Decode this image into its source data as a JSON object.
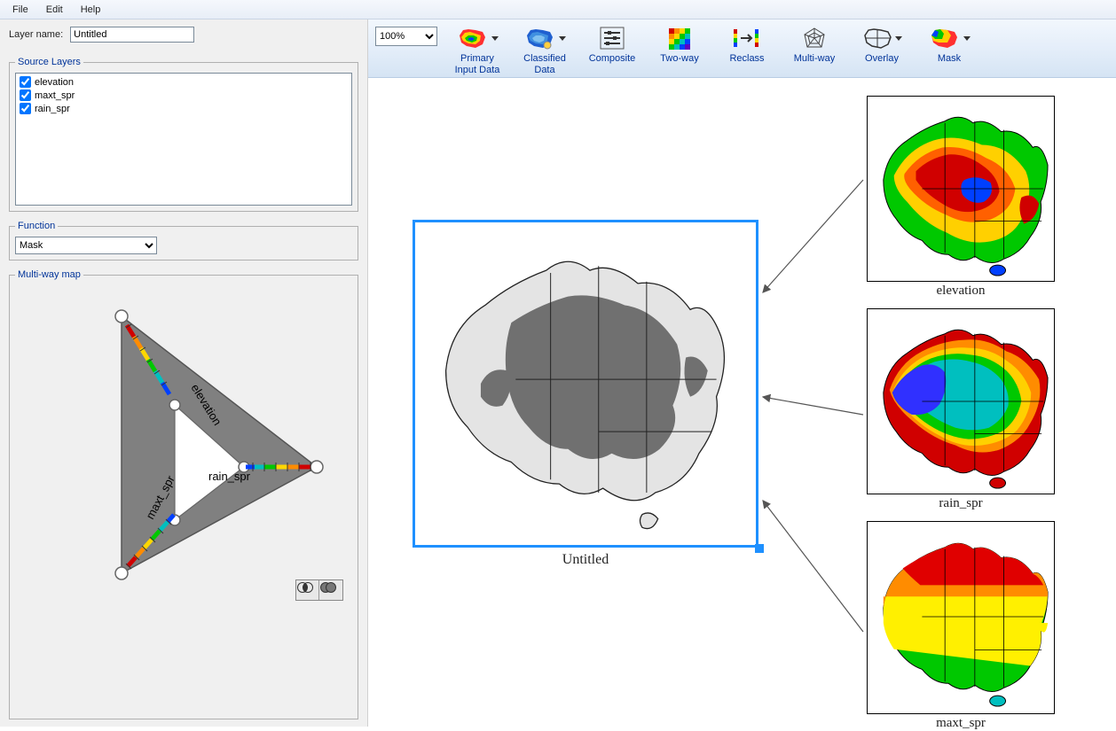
{
  "menubar": {
    "file": "File",
    "edit": "Edit",
    "help": "Help"
  },
  "left": {
    "layer_name_label": "Layer name:",
    "layer_name_value": "Untitled",
    "source_layers_legend": "Source Layers",
    "layers": [
      {
        "name": "elevation",
        "checked": true
      },
      {
        "name": "maxt_spr",
        "checked": true
      },
      {
        "name": "rain_spr",
        "checked": true
      }
    ],
    "function_legend": "Function",
    "function_value": "Mask",
    "multiway_legend": "Multi-way map",
    "triangle_labels": {
      "top": "elevation",
      "right": "rain_spr",
      "left": "maxt_spr"
    }
  },
  "toolbar": {
    "zoom": "100%",
    "buttons": {
      "primary": "Primary Input Data",
      "classified": "Classified Data",
      "composite": "Composite",
      "twoway": "Two-way",
      "reclass": "Reclass",
      "multiway": "Multi-way",
      "overlay": "Overlay",
      "mask": "Mask"
    }
  },
  "workspace": {
    "output_label": "Untitled",
    "thumbs": {
      "elevation": "elevation",
      "rain_spr": "rain_spr",
      "maxt_spr": "maxt_spr"
    }
  },
  "colors": {
    "accent": "#1e90ff",
    "link": "#003399"
  }
}
